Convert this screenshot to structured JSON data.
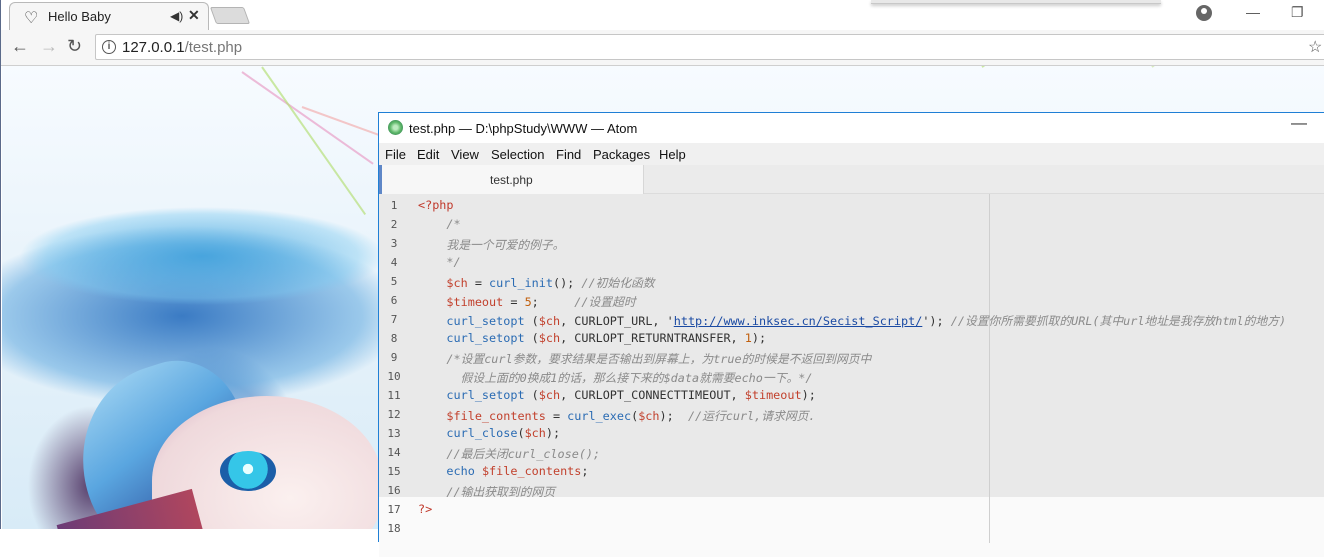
{
  "browser": {
    "tab_title": "Hello Baby",
    "url_host": "127.0.0.1",
    "url_path": "/test.php"
  },
  "atom": {
    "window_title": "test.php — D:\\phpStudy\\WWW — Atom",
    "menu": [
      "File",
      "Edit",
      "View",
      "Selection",
      "Find",
      "Packages",
      "Help"
    ],
    "tab_label": "test.php",
    "lines": [
      {
        "n": "1",
        "tokens": [
          {
            "t": "<?php",
            "c": "tag"
          }
        ]
      },
      {
        "n": "2",
        "tokens": [
          {
            "t": "    /*",
            "c": "com"
          }
        ]
      },
      {
        "n": "3",
        "tokens": [
          {
            "t": "    我是一个可爱的例子。",
            "c": "com"
          }
        ]
      },
      {
        "n": "4",
        "tokens": [
          {
            "t": "    */",
            "c": "com"
          }
        ]
      },
      {
        "n": "5",
        "tokens": [
          {
            "t": "    ",
            "c": "plain"
          },
          {
            "t": "$ch",
            "c": "var"
          },
          {
            "t": " = ",
            "c": "plain"
          },
          {
            "t": "curl_init",
            "c": "fn"
          },
          {
            "t": "(); ",
            "c": "plain"
          },
          {
            "t": "//初始化函数",
            "c": "com"
          }
        ]
      },
      {
        "n": "6",
        "tokens": [
          {
            "t": "    ",
            "c": "plain"
          },
          {
            "t": "$timeout",
            "c": "var"
          },
          {
            "t": " = ",
            "c": "plain"
          },
          {
            "t": "5",
            "c": "num"
          },
          {
            "t": ";     ",
            "c": "plain"
          },
          {
            "t": "//设置超时",
            "c": "com"
          }
        ]
      },
      {
        "n": "7",
        "tokens": [
          {
            "t": "    ",
            "c": "plain"
          },
          {
            "t": "curl_setopt",
            "c": "fn"
          },
          {
            "t": " (",
            "c": "plain"
          },
          {
            "t": "$ch",
            "c": "var"
          },
          {
            "t": ", CURLOPT_URL, '",
            "c": "plain"
          },
          {
            "t": "http://www.inksec.cn/Secist_Script/",
            "c": "link"
          },
          {
            "t": "'); ",
            "c": "plain"
          },
          {
            "t": "//设置你所需要抓取的URL(其中url地址是我存放html的地方)",
            "c": "com"
          }
        ]
      },
      {
        "n": "8",
        "tokens": [
          {
            "t": "    ",
            "c": "plain"
          },
          {
            "t": "curl_setopt",
            "c": "fn"
          },
          {
            "t": " (",
            "c": "plain"
          },
          {
            "t": "$ch",
            "c": "var"
          },
          {
            "t": ", CURLOPT_RETURNTRANSFER, ",
            "c": "plain"
          },
          {
            "t": "1",
            "c": "num"
          },
          {
            "t": ");",
            "c": "plain"
          }
        ]
      },
      {
        "n": "9",
        "tokens": [
          {
            "t": "    /*设置curl参数，要求结果是否输出到屏幕上，为true的时候是不返回到网页中",
            "c": "com"
          }
        ]
      },
      {
        "n": "10",
        "tokens": [
          {
            "t": "      假设上面的0换成1的话，那么接下来的$data就需要echo一下。*/",
            "c": "com"
          }
        ]
      },
      {
        "n": "11",
        "tokens": [
          {
            "t": "    ",
            "c": "plain"
          },
          {
            "t": "curl_setopt",
            "c": "fn"
          },
          {
            "t": " (",
            "c": "plain"
          },
          {
            "t": "$ch",
            "c": "var"
          },
          {
            "t": ", CURLOPT_CONNECTTIMEOUT, ",
            "c": "plain"
          },
          {
            "t": "$timeout",
            "c": "var"
          },
          {
            "t": ");",
            "c": "plain"
          }
        ]
      },
      {
        "n": "12",
        "tokens": [
          {
            "t": "    ",
            "c": "plain"
          },
          {
            "t": "$file_contents",
            "c": "var"
          },
          {
            "t": " = ",
            "c": "plain"
          },
          {
            "t": "curl_exec",
            "c": "fn"
          },
          {
            "t": "(",
            "c": "plain"
          },
          {
            "t": "$ch",
            "c": "var"
          },
          {
            "t": ");  ",
            "c": "plain"
          },
          {
            "t": "//运行curl,请求网页.",
            "c": "com"
          }
        ]
      },
      {
        "n": "13",
        "tokens": [
          {
            "t": "    ",
            "c": "plain"
          },
          {
            "t": "curl_close",
            "c": "fn"
          },
          {
            "t": "(",
            "c": "plain"
          },
          {
            "t": "$ch",
            "c": "var"
          },
          {
            "t": ");",
            "c": "plain"
          }
        ]
      },
      {
        "n": "14",
        "tokens": [
          {
            "t": "    //最后关闭curl_close();",
            "c": "com"
          }
        ]
      },
      {
        "n": "15",
        "tokens": [
          {
            "t": "    ",
            "c": "plain"
          },
          {
            "t": "echo",
            "c": "kw"
          },
          {
            "t": " ",
            "c": "plain"
          },
          {
            "t": "$file_contents",
            "c": "var"
          },
          {
            "t": ";",
            "c": "plain"
          }
        ]
      },
      {
        "n": "16",
        "tokens": [
          {
            "t": "    //输出获取到的网页",
            "c": "com"
          }
        ]
      },
      {
        "n": "17",
        "tokens": [
          {
            "t": "?>",
            "c": "tag"
          }
        ]
      },
      {
        "n": "18",
        "tokens": []
      }
    ]
  },
  "colors": {
    "atom_border": "#1f7fd5",
    "php_tag": "#c0392b",
    "variable": "#c2412d",
    "function": "#2a6bb3",
    "comment": "#8a8a8a"
  }
}
